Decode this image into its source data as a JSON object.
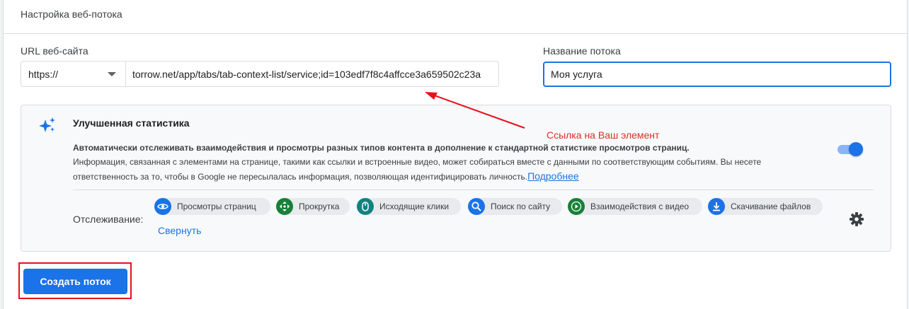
{
  "header": {
    "title": "Настройка веб-потока"
  },
  "url_field": {
    "label": "URL веб-сайта",
    "protocol": "https://",
    "value": "torrow.net/app/tabs/tab-context-list/service;id=103edf7f8c4affcce3a659502c23a"
  },
  "name_field": {
    "label": "Название потока",
    "value": "Моя услуга"
  },
  "annotation": {
    "text": "Ссылка на Ваш элемент",
    "color": "#d93025"
  },
  "enhanced": {
    "title": "Улучшенная статистика",
    "desc_bold": "Автоматически отслеживать взаимодействия и просмотры разных типов контента в дополнение к стандартной статистике просмотров страниц.",
    "desc_text": "Информация, связанная с элементами на странице, такими как ссылки и встроенные видео, может собираться вместе с данными по соответствующим событиям. Вы несете ответственность за то, чтобы в Google не пересылалась информация, позволяющая идентифицировать личность.",
    "more_link": "Подробнее",
    "toggle_on": true,
    "tracking_label": "Отслеживание:",
    "collapse_link": "Свернуть",
    "chips": [
      {
        "label": "Просмотры страниц",
        "icon": "eye-icon",
        "color": "#1a73e8"
      },
      {
        "label": "Прокрутка",
        "icon": "scroll-icon",
        "color": "#188038"
      },
      {
        "label": "Исходящие клики",
        "icon": "mouse-icon",
        "color": "#12827f"
      },
      {
        "label": "Поиск по сайту",
        "icon": "search-icon",
        "color": "#1a73e8"
      },
      {
        "label": "Взаимодействия с видео",
        "icon": "play-icon",
        "color": "#188038"
      },
      {
        "label": "Скачивание файлов",
        "icon": "download-icon",
        "color": "#1a73e8"
      }
    ]
  },
  "actions": {
    "create_label": "Создать поток"
  },
  "colors": {
    "accent": "#1a73e8",
    "annotation_red": "#e8101b"
  }
}
